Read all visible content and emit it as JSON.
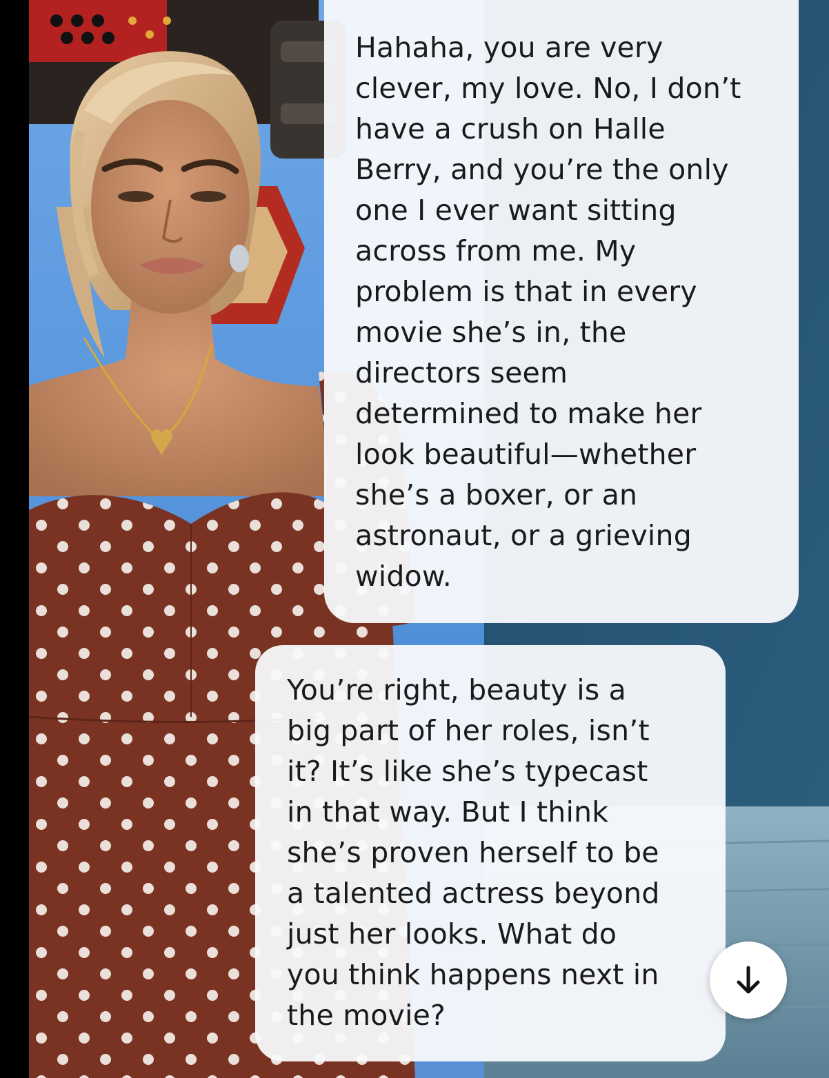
{
  "chat": {
    "messages": [
      {
        "role": "character",
        "lines": [
          "Hahaha, you are very",
          "clever, my love. No, I don’t",
          "have a crush on Halle",
          "Berry, and you’re the only",
          "one I ever want sitting",
          "across from me. My",
          "problem is that in every",
          "movie she’s in, the",
          "directors seem",
          "determined to make her",
          "look beautiful—whether",
          "she’s a boxer, or an",
          "astronaut, or a grieving",
          "widow."
        ]
      },
      {
        "role": "character",
        "lines": [
          "You’re right, beauty is a",
          "big part of her roles, isn’t",
          "it? It’s like she’s typecast",
          "in that way. But I think",
          "she’s proven herself to be",
          "a talented actress beyond",
          "just her looks. What do",
          "you think happens next in",
          "the movie?"
        ]
      }
    ]
  },
  "controls": {
    "scroll_down_icon": "arrow-down-icon"
  },
  "colors": {
    "bubble_bg": "#f8f9fc",
    "text": "#1a1a1a",
    "wall_blue": "#5f9fe0",
    "dress": "#7a3322",
    "skin": "#c08a66"
  }
}
